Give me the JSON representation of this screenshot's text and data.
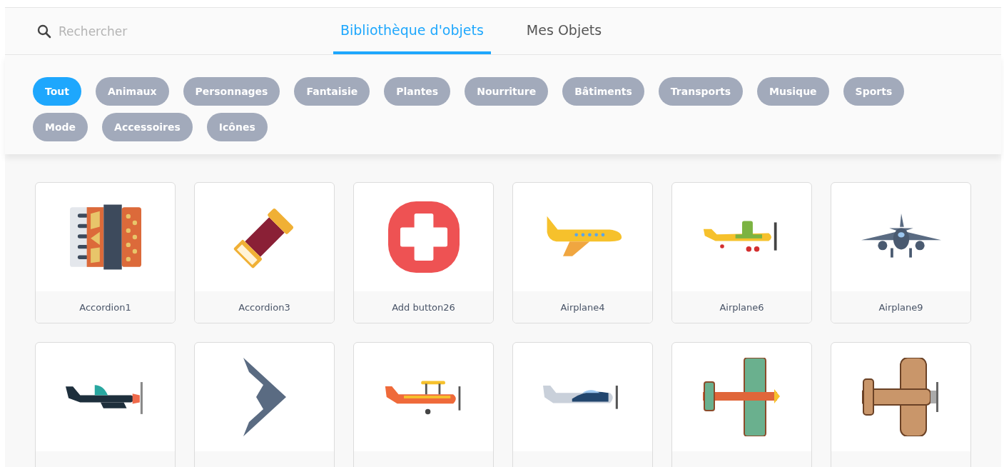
{
  "search": {
    "placeholder": "Rechercher"
  },
  "tabs": [
    {
      "label": "Bibliothèque d'objets",
      "selected": true
    },
    {
      "label": "Mes Objets",
      "selected": false
    }
  ],
  "categories": [
    {
      "label": "Tout",
      "selected": true
    },
    {
      "label": "Animaux",
      "selected": false
    },
    {
      "label": "Personnages",
      "selected": false
    },
    {
      "label": "Fantaisie",
      "selected": false
    },
    {
      "label": "Plantes",
      "selected": false
    },
    {
      "label": "Nourriture",
      "selected": false
    },
    {
      "label": "Bâtiments",
      "selected": false
    },
    {
      "label": "Transports",
      "selected": false
    },
    {
      "label": "Musique",
      "selected": false
    },
    {
      "label": "Sports",
      "selected": false
    },
    {
      "label": "Mode",
      "selected": false
    },
    {
      "label": "Accessoires",
      "selected": false
    },
    {
      "label": "Icônes",
      "selected": false
    }
  ],
  "objects": [
    {
      "name": "Accordion1",
      "kind": "accordion"
    },
    {
      "name": "Accordion3",
      "kind": "accordion-tilted"
    },
    {
      "name": "Add button26",
      "kind": "plus-button"
    },
    {
      "name": "Airplane4",
      "kind": "jet"
    },
    {
      "name": "Airplane6",
      "kind": "propeller-plane"
    },
    {
      "name": "Airplane9",
      "kind": "jet-front"
    },
    {
      "kind": "fighter-plane"
    },
    {
      "kind": "stealth-plane"
    },
    {
      "kind": "biplane"
    },
    {
      "kind": "small-plane"
    },
    {
      "kind": "topdown-plane"
    },
    {
      "kind": "topdown-biplane"
    }
  ]
}
